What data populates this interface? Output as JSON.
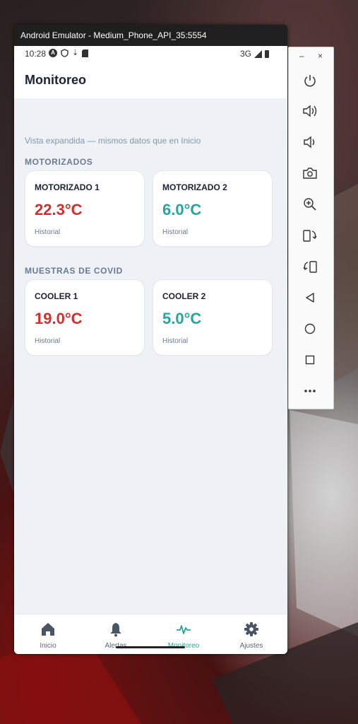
{
  "emulator": {
    "window_title": "Android Emulator - Medium_Phone_API_35:5554",
    "toolbar": {
      "minimize_label": "–",
      "close_label": "×",
      "buttons": [
        "power-icon",
        "volume-up-icon",
        "volume-down-icon",
        "camera-icon",
        "zoom-in-icon",
        "rotate-left-icon",
        "rotate-right-icon",
        "back-icon",
        "home-icon",
        "overview-icon",
        "more-icon"
      ]
    }
  },
  "status_bar": {
    "time": "10:28",
    "network": "3G"
  },
  "app": {
    "title": "Monitoreo",
    "subtitle": "Vista expandida — mismos datos que en Inicio",
    "sections": [
      {
        "label": "MOTORIZADOS",
        "cards": [
          {
            "name": "MOTORIZADO 1",
            "temp": "22.3°C",
            "status": "alert",
            "link": "Historial"
          },
          {
            "name": "MOTORIZADO 2",
            "temp": "6.0°C",
            "status": "ok",
            "link": "Historial"
          }
        ]
      },
      {
        "label": "MUESTRAS DE COVID",
        "cards": [
          {
            "name": "COOLER 1",
            "temp": "19.0°C",
            "status": "alert",
            "link": "Historial"
          },
          {
            "name": "COOLER 2",
            "temp": "5.0°C",
            "status": "ok",
            "link": "Historial"
          }
        ]
      }
    ],
    "nav": [
      {
        "label": "Inicio",
        "icon": "home-icon",
        "active": false
      },
      {
        "label": "Alertas",
        "icon": "bell-icon",
        "active": false
      },
      {
        "label": "Monitoreo",
        "icon": "pulse-icon",
        "active": true
      },
      {
        "label": "Ajustes",
        "icon": "gear-icon",
        "active": false
      }
    ]
  },
  "colors": {
    "alert": "#d32f2f",
    "ok": "#26a69a",
    "background": "#eef2f7"
  }
}
